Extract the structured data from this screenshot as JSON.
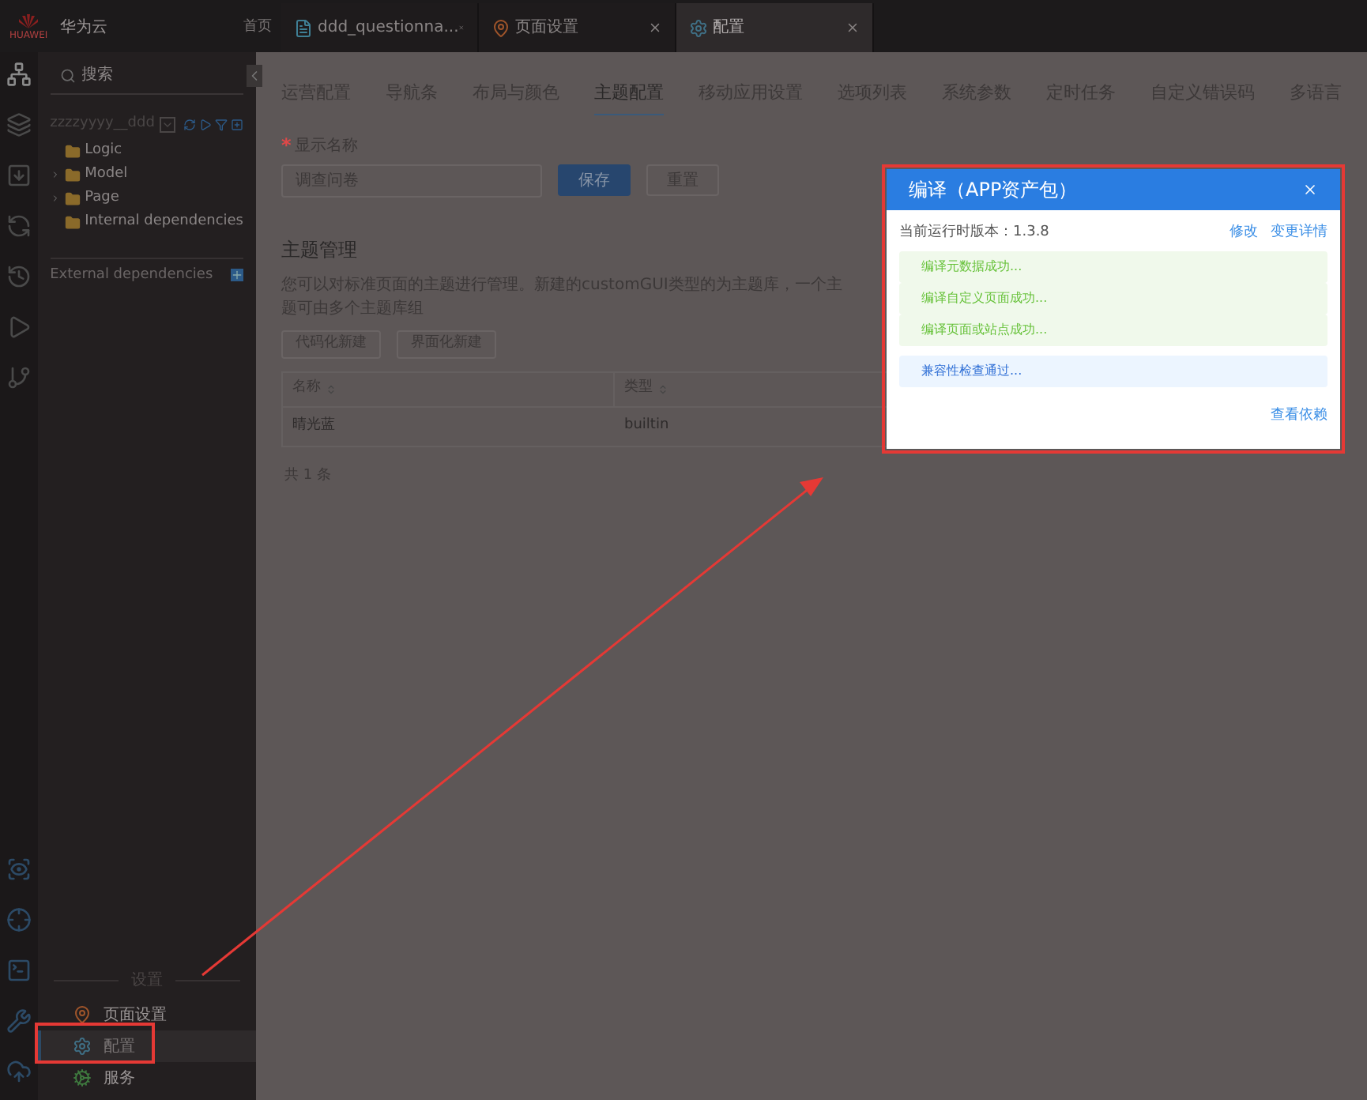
{
  "topbar": {
    "brand": "华为云",
    "home": "首页",
    "logo_text": "HUAWEI",
    "tabs": [
      {
        "label": "ddd_questionna...",
        "kind": "file",
        "selected": false
      },
      {
        "label": "页面设置",
        "kind": "pin",
        "selected": false
      },
      {
        "label": "配置",
        "kind": "gear",
        "selected": true
      }
    ]
  },
  "sidebar": {
    "search": {
      "placeholder": "搜索"
    },
    "project": "zzzzyyyy__ddd",
    "tree": [
      {
        "label": "Logic"
      },
      {
        "label": "Model",
        "expanded": false
      },
      {
        "label": "Page",
        "expanded": false
      },
      {
        "label": "Internal dependencies"
      }
    ],
    "external": "External dependencies",
    "section": "设置",
    "items": [
      {
        "label": "页面设置",
        "kind": "pin",
        "selected": false
      },
      {
        "label": "配置",
        "kind": "gear",
        "selected": true
      },
      {
        "label": "服务",
        "kind": "service",
        "selected": false
      }
    ]
  },
  "main": {
    "tabs": [
      {
        "label": "运营配置",
        "selected": false
      },
      {
        "label": "导航条",
        "selected": false
      },
      {
        "label": "布局与颜色",
        "selected": false
      },
      {
        "label": "主题配置",
        "selected": true
      },
      {
        "label": "移动应用设置",
        "selected": false
      },
      {
        "label": "选项列表",
        "selected": false
      },
      {
        "label": "系统参数",
        "selected": false
      },
      {
        "label": "定时任务",
        "selected": false
      },
      {
        "label": "自定义错误码",
        "selected": false
      },
      {
        "label": "多语言",
        "selected": false
      }
    ],
    "form": {
      "required_mark": "*",
      "label": "显示名称",
      "value": "调查问卷",
      "save": "保存",
      "reset": "重置"
    },
    "section_title": "主题管理",
    "description": "您可以对标准页面的主题进行管理。新建的customGUI类型的为主题库，一个主题可由多个主题库组",
    "buttons": [
      "代码化新建",
      "界面化新建"
    ],
    "table": {
      "columns": [
        "名称",
        "类型"
      ],
      "rows": [
        [
          "晴光蓝",
          "builtin"
        ]
      ]
    },
    "total": "共 1 条"
  },
  "dialog": {
    "title": "编译（APP资产包）",
    "version_label": "当前运行时版本：",
    "version": "1.3.8",
    "links": [
      "修改",
      "变更详情"
    ],
    "messages": [
      {
        "text": "编译元数据成功...",
        "kind": "success"
      },
      {
        "text": "编译自定义页面成功...",
        "kind": "success"
      },
      {
        "text": "编译页面或站点成功...",
        "kind": "success"
      },
      {
        "text": "兼容性检查通过...",
        "kind": "info"
      }
    ],
    "footer_link": "查看依赖"
  }
}
